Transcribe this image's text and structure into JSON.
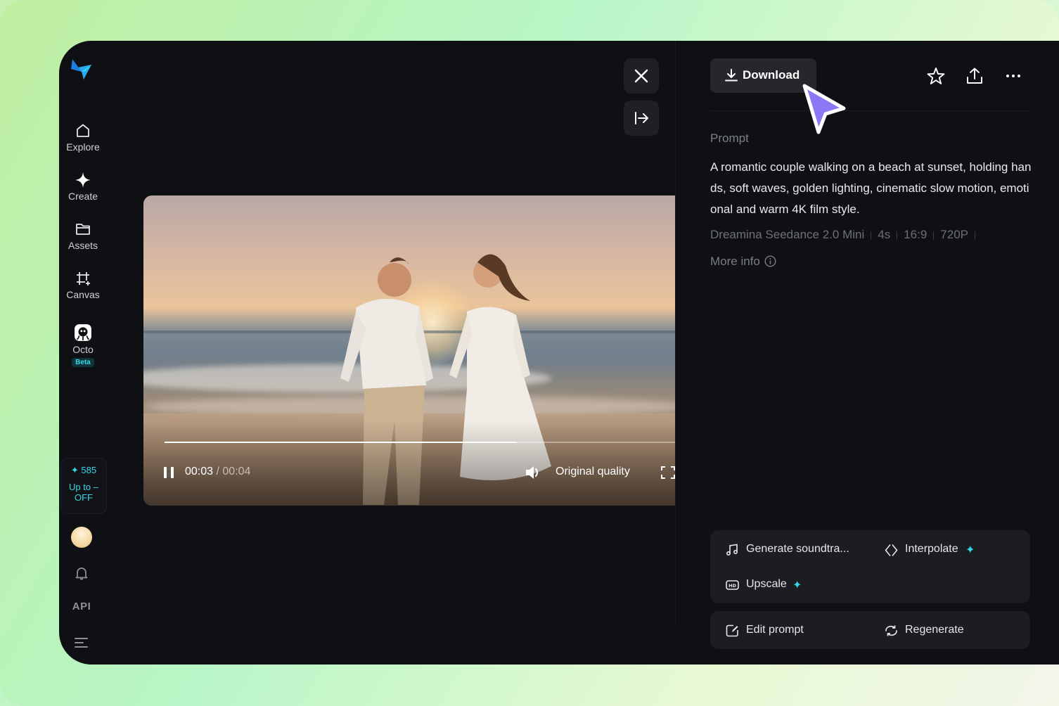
{
  "sidebar": {
    "logo": "dreamina-logo-icon",
    "items": [
      {
        "label": "Explore",
        "icon": "home-icon"
      },
      {
        "label": "Create",
        "icon": "sparkle-icon"
      },
      {
        "label": "Assets",
        "icon": "folder-icon"
      },
      {
        "label": "Canvas",
        "icon": "canvas-icon"
      },
      {
        "label": "Octo",
        "icon": "octo-icon",
        "badge": "Beta"
      }
    ],
    "credits": {
      "amount": "585",
      "promo_line1": "Up to –",
      "promo_line2": "OFF"
    },
    "api_label": "API"
  },
  "viewer": {
    "close_icon": "close-icon",
    "collapse_icon": "collapse-panel-icon",
    "current_time": "00:03",
    "separator": " / ",
    "duration": "00:04",
    "progress": 0.69,
    "quality_label": "Original quality"
  },
  "panel": {
    "download_label": "Download",
    "prompt_label": "Prompt",
    "prompt_text": "A romantic couple walking on a beach at sunset, holding hands, soft waves, golden lighting, cinematic slow motion, emotional and warm 4K film style.",
    "meta": [
      "Dreamina Seedance 2.0 Mini",
      "4s",
      "16:9",
      "720P"
    ],
    "more_info_label": "More info",
    "tools": {
      "soundtrack": "Generate soundtra...",
      "interpolate": "Interpolate",
      "upscale": "Upscale"
    },
    "actions": {
      "edit_prompt": "Edit prompt",
      "regenerate": "Regenerate"
    }
  },
  "colors": {
    "app_bg": "#0f1013",
    "accent_cyan": "#36d3ea",
    "cursor_purple": "#8a78f5"
  }
}
